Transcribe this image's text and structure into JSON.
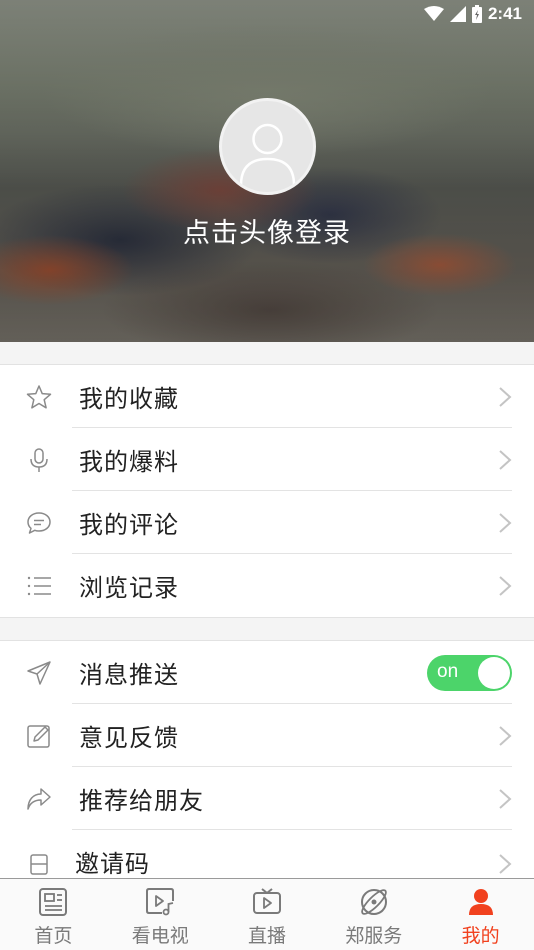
{
  "status_bar": {
    "time": "2:41",
    "icons": [
      "wifi-icon",
      "cellular-signal-icon",
      "battery-icon"
    ]
  },
  "profile": {
    "avatar_icon": "default-avatar-icon",
    "login_prompt": "点击头像登录"
  },
  "menu_group_1": [
    {
      "label": "我的收藏",
      "icon": "star-icon"
    },
    {
      "label": "我的爆料",
      "icon": "microphone-icon"
    },
    {
      "label": "我的评论",
      "icon": "comment-icon"
    },
    {
      "label": "浏览记录",
      "icon": "list-icon"
    }
  ],
  "menu_group_2": {
    "push": {
      "label": "消息推送",
      "icon": "send-icon",
      "toggle_text": "on",
      "enabled": true
    },
    "items": [
      {
        "label": "意见反馈",
        "icon": "edit-icon"
      },
      {
        "label": "推荐给朋友",
        "icon": "share-icon"
      },
      {
        "label": "邀请码",
        "icon": "invite-code-icon"
      }
    ]
  },
  "bottom_nav": [
    {
      "label": "首页",
      "icon": "newspaper-icon",
      "active": false
    },
    {
      "label": "看电视",
      "icon": "video-icon",
      "active": false
    },
    {
      "label": "直播",
      "icon": "tv-icon",
      "active": false
    },
    {
      "label": "郑服务",
      "icon": "planet-icon",
      "active": false
    },
    {
      "label": "我的",
      "icon": "user-icon",
      "active": true
    }
  ],
  "colors": {
    "accent": "#f1411e",
    "toggle_on": "#4cd46a",
    "icon_gray": "#8a8a8a"
  }
}
